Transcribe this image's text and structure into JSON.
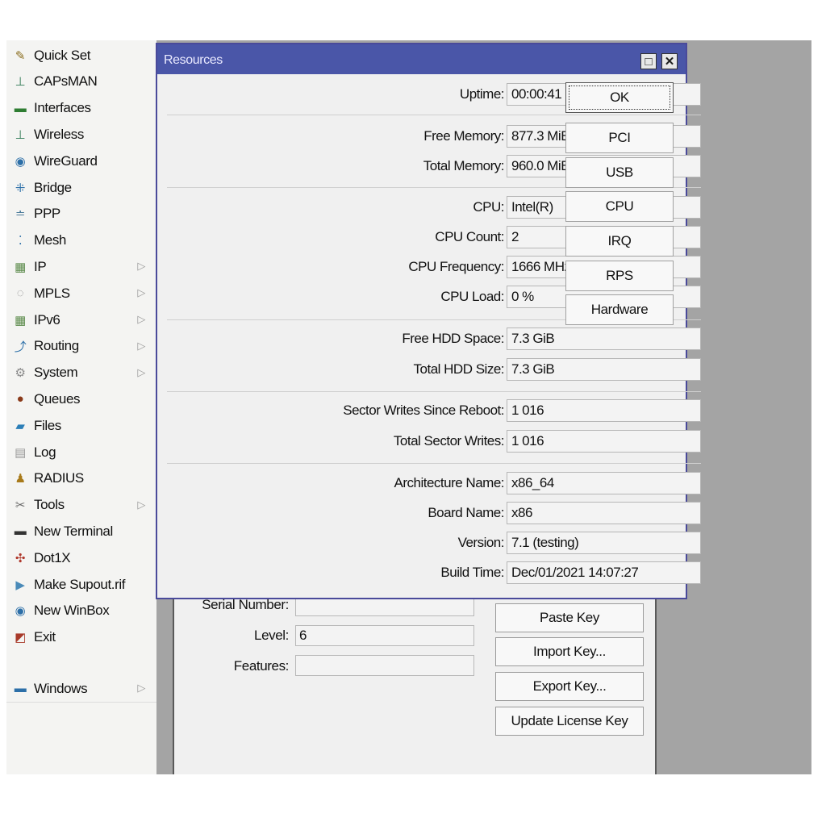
{
  "sidebar": {
    "items": [
      {
        "label": "Quick Set",
        "icon": "quick-set-icon",
        "glyph": "✎",
        "color": "#8a6d1e",
        "has_submenu": false
      },
      {
        "label": "CAPsMAN",
        "icon": "capsman-icon",
        "glyph": "⊥",
        "color": "#2f7a55",
        "has_submenu": false
      },
      {
        "label": "Interfaces",
        "icon": "interfaces-icon",
        "glyph": "▬",
        "color": "#2e7d32",
        "has_submenu": false
      },
      {
        "label": "Wireless",
        "icon": "wireless-icon",
        "glyph": "⊥",
        "color": "#2f7a55",
        "has_submenu": false
      },
      {
        "label": "WireGuard",
        "icon": "wireguard-icon",
        "glyph": "◉",
        "color": "#2c6fa8",
        "has_submenu": false
      },
      {
        "label": "Bridge",
        "icon": "bridge-icon",
        "glyph": "⁜",
        "color": "#2c6fa8",
        "has_submenu": false
      },
      {
        "label": "PPP",
        "icon": "ppp-icon",
        "glyph": "≐",
        "color": "#4a7a9a",
        "has_submenu": false
      },
      {
        "label": "Mesh",
        "icon": "mesh-icon",
        "glyph": "⁚",
        "color": "#2c6fa8",
        "has_submenu": false
      },
      {
        "label": "IP",
        "icon": "ip-icon",
        "glyph": "▦",
        "color": "#5a8a4a",
        "has_submenu": true
      },
      {
        "label": "MPLS",
        "icon": "mpls-icon",
        "glyph": "◌",
        "color": "#888888",
        "has_submenu": true
      },
      {
        "label": "IPv6",
        "icon": "ipv6-icon",
        "glyph": "▦",
        "color": "#5a8a4a",
        "has_submenu": true
      },
      {
        "label": "Routing",
        "icon": "routing-icon",
        "glyph": "⤴",
        "color": "#2c6fa8",
        "has_submenu": true
      },
      {
        "label": "System",
        "icon": "system-icon",
        "glyph": "⚙",
        "color": "#8a8a8a",
        "has_submenu": true
      },
      {
        "label": "Queues",
        "icon": "queues-icon",
        "glyph": "●",
        "color": "#8a3a1a",
        "has_submenu": false
      },
      {
        "label": "Files",
        "icon": "files-icon",
        "glyph": "▰",
        "color": "#2c7fb8",
        "has_submenu": false
      },
      {
        "label": "Log",
        "icon": "log-icon",
        "glyph": "▤",
        "color": "#9a9a9a",
        "has_submenu": false
      },
      {
        "label": "RADIUS",
        "icon": "radius-icon",
        "glyph": "♟",
        "color": "#a87a1a",
        "has_submenu": false
      },
      {
        "label": "Tools",
        "icon": "tools-icon",
        "glyph": "✂",
        "color": "#6a6a6a",
        "has_submenu": true
      },
      {
        "label": "New Terminal",
        "icon": "terminal-icon",
        "glyph": "▬",
        "color": "#333333",
        "has_submenu": false
      },
      {
        "label": "Dot1X",
        "icon": "dot1x-icon",
        "glyph": "✣",
        "color": "#b03a2e",
        "has_submenu": false
      },
      {
        "label": "Make Supout.rif",
        "icon": "supout-icon",
        "glyph": "▶",
        "color": "#4a8ab8",
        "has_submenu": false
      },
      {
        "label": "New WinBox",
        "icon": "winbox-icon",
        "glyph": "◉",
        "color": "#2c6fa8",
        "has_submenu": false
      },
      {
        "label": "Exit",
        "icon": "exit-icon",
        "glyph": "◩",
        "color": "#a83a2a",
        "has_submenu": false
      }
    ],
    "windows_item": {
      "label": "Windows",
      "icon": "windows-icon",
      "glyph": "▬",
      "color": "#2c6fa8",
      "has_submenu": true
    },
    "submenu_arrow": "▷"
  },
  "license_window": {
    "serial_label": "Serial Number:",
    "serial_value": "",
    "level_label": "Level:",
    "level_value": "6",
    "features_label": "Features:",
    "features_value": "",
    "buttons": [
      "Paste Key",
      "Import Key...",
      "Export Key...",
      "Update License Key"
    ]
  },
  "resources_window": {
    "title": "Resources",
    "maximize_glyph": "□",
    "close_glyph": "✕",
    "rows": [
      {
        "label": "Uptime:",
        "value": "00:00:41"
      },
      {
        "label": "Free Memory:",
        "value": "877.3 MiB"
      },
      {
        "label": "Total Memory:",
        "value": "960.0 MiB"
      },
      {
        "label": "CPU:",
        "value": "Intel(R)"
      },
      {
        "label": "CPU Count:",
        "value": "2"
      },
      {
        "label": "CPU Frequency:",
        "value": "1666 MHz"
      },
      {
        "label": "CPU Load:",
        "value": "0 %"
      },
      {
        "label": "Free HDD Space:",
        "value": "7.3 GiB"
      },
      {
        "label": "Total HDD Size:",
        "value": "7.3 GiB"
      },
      {
        "label": "Sector Writes Since Reboot:",
        "value": "1 016"
      },
      {
        "label": "Total Sector Writes:",
        "value": "1 016"
      },
      {
        "label": "Architecture Name:",
        "value": "x86_64"
      },
      {
        "label": "Board Name:",
        "value": "x86"
      },
      {
        "label": "Version:",
        "value": "7.1 (testing)"
      },
      {
        "label": "Build Time:",
        "value": "Dec/01/2021 14:07:27"
      }
    ],
    "buttons": [
      "OK",
      "PCI",
      "USB",
      "CPU",
      "IRQ",
      "RPS",
      "Hardware"
    ]
  }
}
